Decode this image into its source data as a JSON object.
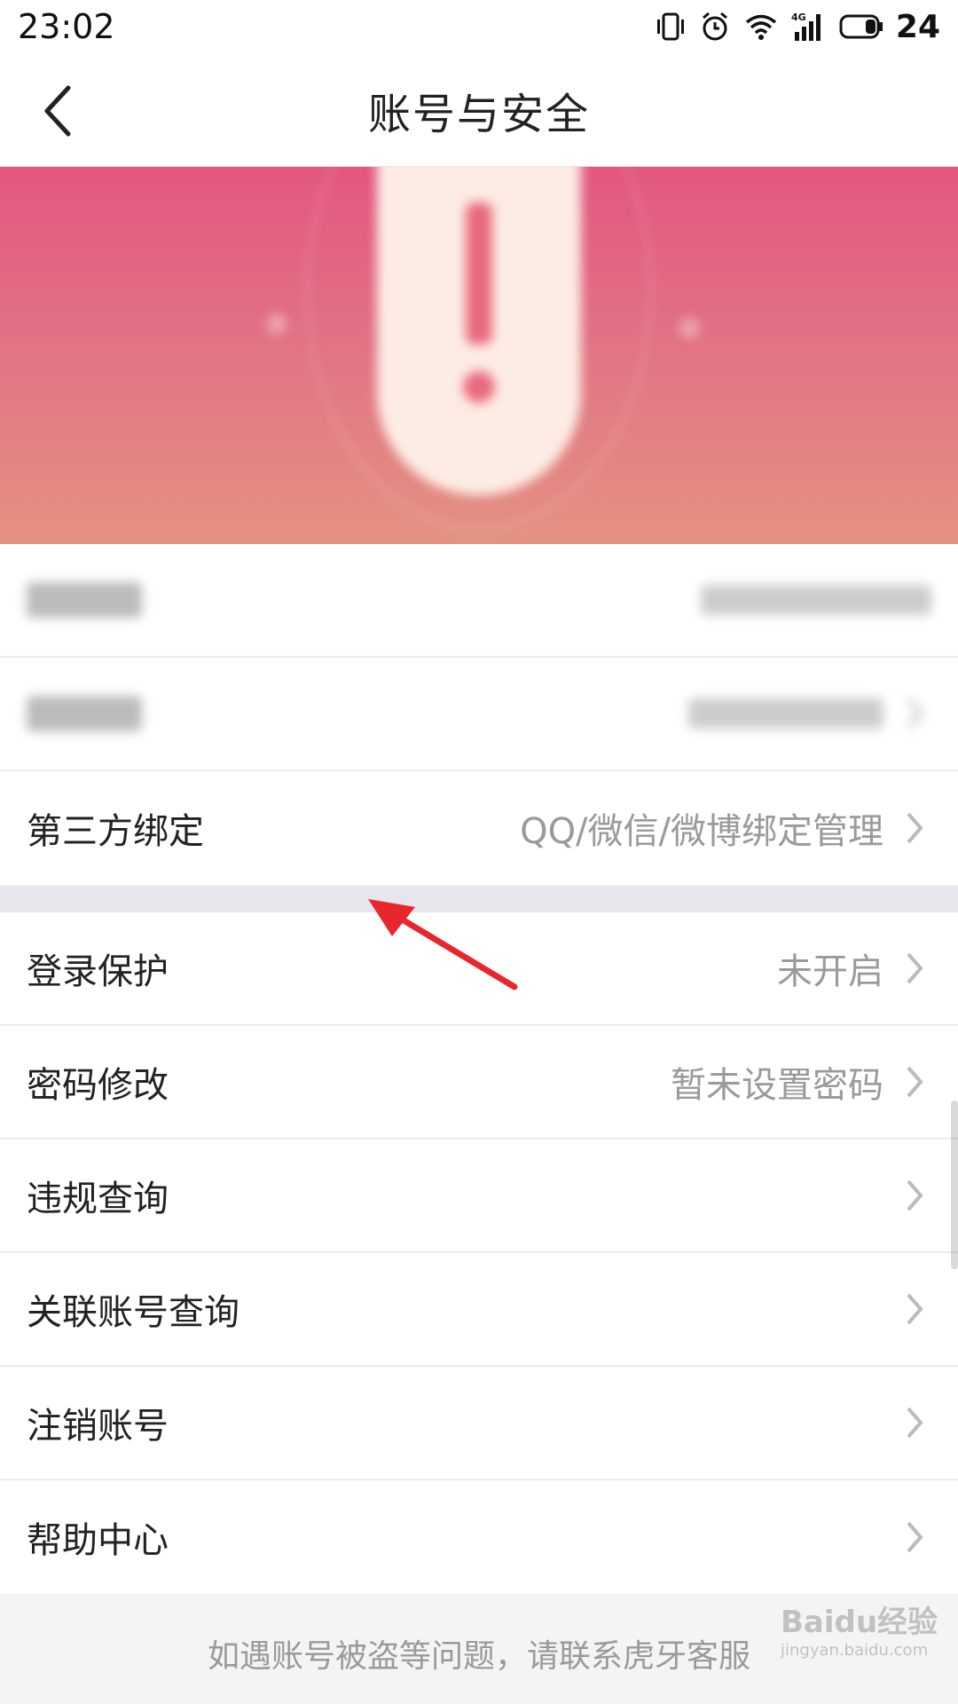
{
  "status_bar": {
    "time": "23:02",
    "network": "4G",
    "battery": "24"
  },
  "nav": {
    "title": "账号与安全"
  },
  "banner": {
    "colors": {
      "top": "#e2577f",
      "bottom": "#e49282"
    }
  },
  "list_top": [
    {
      "label": "第三方绑定",
      "value": "QQ/微信/微博绑定管理"
    }
  ],
  "list_bottom": [
    {
      "label": "登录保护",
      "value": "未开启"
    },
    {
      "label": "密码修改",
      "value": "暂未设置密码"
    },
    {
      "label": "违规查询",
      "value": ""
    },
    {
      "label": "关联账号查询",
      "value": ""
    },
    {
      "label": "注销账号",
      "value": ""
    },
    {
      "label": "帮助中心",
      "value": ""
    }
  ],
  "footer": {
    "text": "如遇账号被盗等问题，请联系虎牙客服"
  },
  "watermark": {
    "brand": "Baidu经验",
    "url": "jingyan.baidu.com"
  },
  "annotation": {
    "color": "#e8262e"
  }
}
